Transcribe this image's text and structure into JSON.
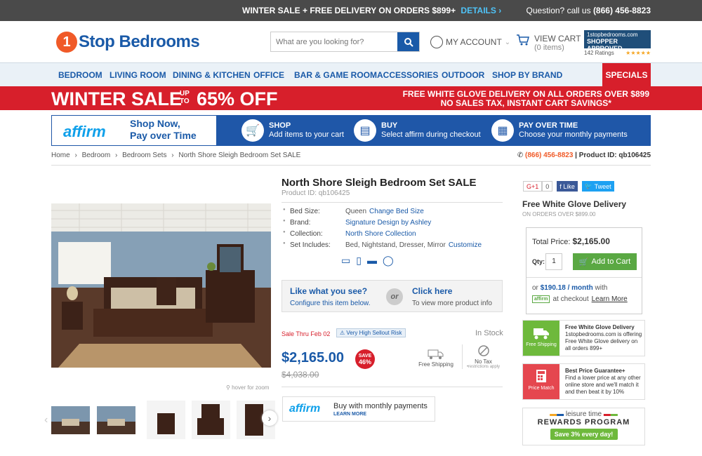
{
  "topbar": {
    "promo": "WINTER SALE + FREE DELIVERY ON ORDERS $899+",
    "details": "DETAILS ›",
    "question": "Question? call us",
    "phone": "(866) 456-8823"
  },
  "header": {
    "logo_num": "1",
    "logo_text": "Stop Bedrooms",
    "search_placeholder": "What are you looking for?",
    "account": "MY ACCOUNT",
    "view_cart": "VIEW CART",
    "cart_items": "(0 items)",
    "approved_site": "1stopbedrooms.com",
    "approved_label": "SHOPPER APPROVED",
    "ratings": "142 Ratings",
    "stars": "★★★★★"
  },
  "nav": {
    "items": [
      "BEDROOM",
      "LIVING ROOM",
      "DINING & KITCHEN",
      "OFFICE",
      "BAR & GAME ROOM",
      "ACCESSORIES",
      "OUTDOOR",
      "SHOP BY BRAND"
    ],
    "specials": "SPECIALS"
  },
  "sale_banner": {
    "left": "WINTER SALE",
    "upto_1": "UP",
    "upto_2": "TO",
    "pct": "65% OFF",
    "right_1": "FREE WHITE GLOVE DELIVERY ON ALL ORDERS OVER $899",
    "right_2": "NO SALES TAX, INSTANT CART SAVINGS*"
  },
  "affirm_banner": {
    "logo": "affirm",
    "tagline_1": "Shop Now,",
    "tagline_2": "Pay over Time",
    "steps": [
      {
        "title": "SHOP",
        "desc": "Add items to your cart"
      },
      {
        "title": "BUY",
        "desc": "Select affirm during checkout"
      },
      {
        "title": "PAY OVER TIME",
        "desc": "Choose your monthly payments"
      }
    ]
  },
  "breadcrumb": [
    "Home",
    "Bedroom",
    "Bedroom Sets",
    "North Shore Sleigh Bedroom Set SALE"
  ],
  "breadcrumb_sep": "›",
  "contact": {
    "phone": "(866) 456-8823",
    "product_id": "| Product ID: qb106425"
  },
  "product": {
    "title": "North Shore Sleigh Bedroom Set SALE",
    "id_line": "Product ID: qb106425",
    "specs": [
      {
        "key": "Bed Size:",
        "value": "Queen",
        "link": "Change Bed Size"
      },
      {
        "key": "Brand:",
        "value": "",
        "link": "Signature Design by Ashley"
      },
      {
        "key": "Collection:",
        "value": "",
        "link": "North Shore Collection"
      },
      {
        "key": "Set Includes:",
        "value": "Bed, Nightstand, Dresser, Mirror",
        "link": "Customize"
      }
    ],
    "like_title": "Like what you see?",
    "like_sub": "Configure this item below.",
    "or": "or",
    "click_title": "Click here",
    "click_sub": "To view more product info",
    "sale_thru": "Sale Thru Feb 02",
    "risk": "Very High Sellout Risk",
    "stock": "In Stock",
    "price": "$2,165.00",
    "old_price": "$4,038.00",
    "save_label": "SAVE",
    "save_pct": "46%",
    "free_shipping": "Free Shipping",
    "no_tax": "No Tax",
    "no_tax_note": "•restrictions apply",
    "hover_zoom": "hover for zoom",
    "affirm_logo": "affirm",
    "affirm_text": "Buy with monthly payments",
    "learn_more": "LEARN MORE"
  },
  "right": {
    "gplus": "G+1",
    "gcount": "0",
    "like": "Like",
    "tweet": "Tweet",
    "fwd_title": "Free White Glove Delivery",
    "fwd_sub": "ON ORDERS OVER $899.00",
    "total_label": "Total Price:",
    "total": "$2,165.00",
    "qty_label": "Qty:",
    "qty": "1",
    "add_to_cart": "Add to Cart",
    "or": "or",
    "monthly": "$190.18 / month",
    "with": "with",
    "affirm_badge": "affirm",
    "at_checkout": "at checkout",
    "learn_more": "Learn More",
    "perks": [
      {
        "icon_label": "Free Shipping",
        "title": "Free White Glove Delivery",
        "body": "1stopbedrooms.com is offering Free White Glove delivery on all orders 899+"
      },
      {
        "icon_label": "Price Match",
        "title": "Best Price Guarantee+",
        "body": "Find a lower price at any other online store and we'll match it and then beat it by 10%"
      }
    ],
    "leisure": "leisure time",
    "rewards": "REWARDS PROGRAM",
    "rewards_save": "Save 3% every day!"
  },
  "colors": {
    "brand_blue": "#1a5aa8",
    "sale_red": "#d71f2b",
    "cart_green": "#5aa843",
    "affirm_blue": "#0fa0ea"
  }
}
